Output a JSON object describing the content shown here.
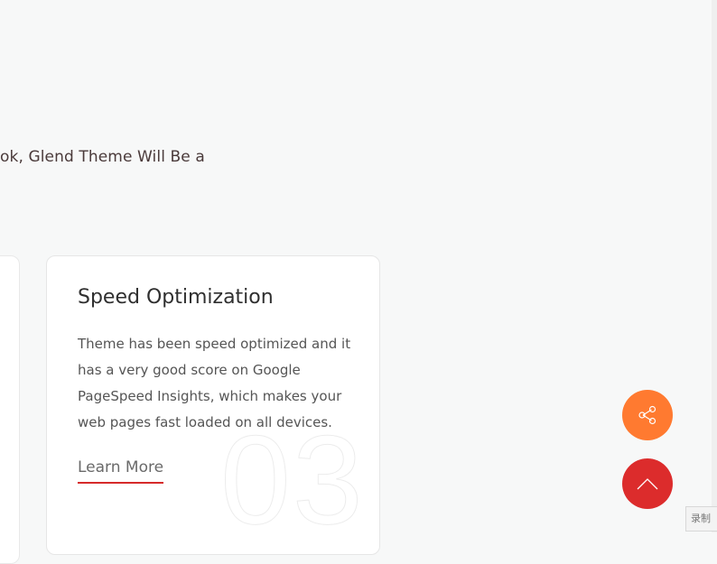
{
  "hero": {
    "tagline": "ok, Glend Theme Will Be a"
  },
  "feature_card": {
    "title": "Speed Optimization",
    "description": "Theme has been speed optimized and it has a very good score on Google PageSpeed Insights, which makes your web pages fast loaded on all devices.",
    "link_label": "Learn More",
    "number": "03"
  },
  "floating_buttons": {
    "share_icon": "share-icon",
    "share_color": "#ff7a30",
    "top_icon": "chevron-up-icon",
    "top_color": "#dc2c2c"
  },
  "watermark": {
    "label": "录制"
  }
}
